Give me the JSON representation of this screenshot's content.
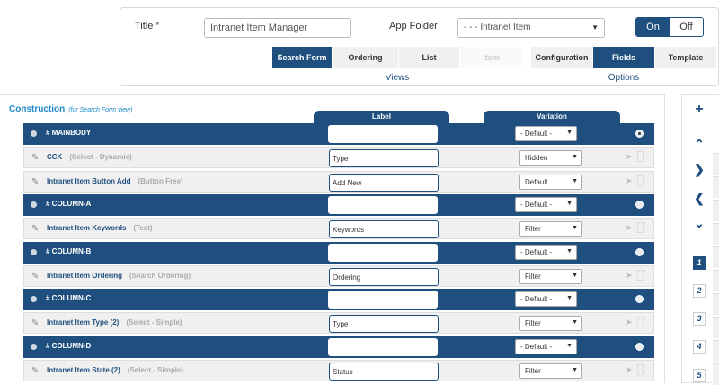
{
  "form": {
    "title_label": "Title",
    "required_mark": "*",
    "title_value": "Intranet Item Manager",
    "folder_label": "App Folder",
    "folder_value": "- - - Intranet Item",
    "toggle_on": "On",
    "toggle_off": "Off"
  },
  "views_tabs": [
    "Search Form",
    "Ordering",
    "List",
    "Item"
  ],
  "views_label": "Views",
  "options_tabs": [
    "Configuration",
    "Fields",
    "Template"
  ],
  "options_label": "Options",
  "construction": {
    "title": "Construction",
    "note": "(for Search Form view)",
    "label_header": "Label",
    "variation_header": "Variation"
  },
  "rows": [
    {
      "type": "dark",
      "name": "# MAINBODY",
      "sub": "",
      "label": "",
      "variation": "- Default -"
    },
    {
      "type": "light",
      "name": "CCK",
      "sub": "(Select - Dynamic)",
      "label": "Type",
      "variation": "Hidden"
    },
    {
      "type": "light",
      "name": "Intranet Item Button Add",
      "sub": "(Button Free)",
      "label": "Add New",
      "variation": "Default"
    },
    {
      "type": "dark",
      "name": "# COLUMN-A",
      "sub": "",
      "label": "",
      "variation": "- Default -"
    },
    {
      "type": "light",
      "name": "Intranet Item Keywords",
      "sub": "(Text)",
      "label": "Keywords",
      "variation": "Filter"
    },
    {
      "type": "dark",
      "name": "# COLUMN-B",
      "sub": "",
      "label": "",
      "variation": "- Default -"
    },
    {
      "type": "light",
      "name": "Intranet Item Ordering",
      "sub": "(Search Ordering)",
      "label": "Ordering",
      "variation": "Filter"
    },
    {
      "type": "dark",
      "name": "# COLUMN-C",
      "sub": "",
      "label": "",
      "variation": "- Default -"
    },
    {
      "type": "light",
      "name": "Intranet Item Type (2)",
      "sub": "(Select - Simple)",
      "label": "Type",
      "variation": "Filter"
    },
    {
      "type": "dark",
      "name": "# COLUMN-D",
      "sub": "",
      "label": "",
      "variation": "- Default -"
    },
    {
      "type": "light",
      "name": "Intranet Item State (2)",
      "sub": "(Select - Simple)",
      "label": "Status",
      "variation": "Filter"
    }
  ],
  "side": {
    "buttons": [
      "+",
      "^",
      ">",
      "<",
      "v"
    ],
    "pages": [
      "1",
      "2",
      "3",
      "4",
      "5"
    ]
  }
}
